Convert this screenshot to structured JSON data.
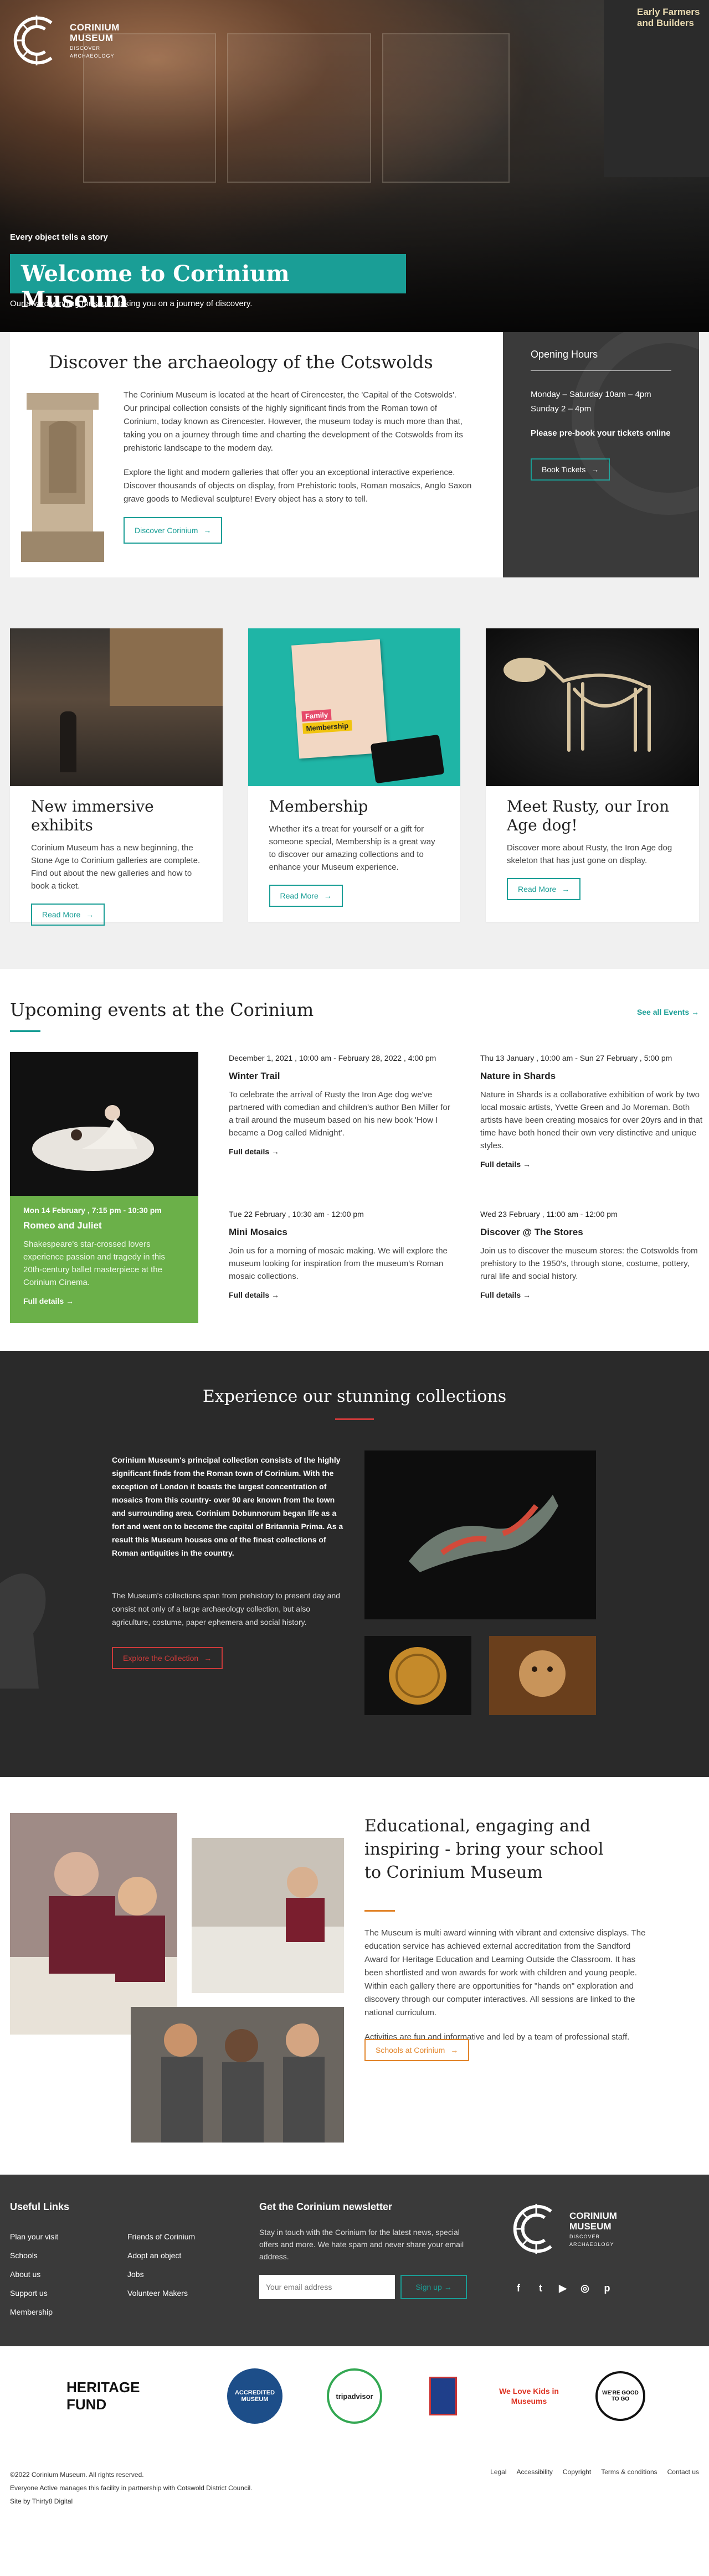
{
  "brand": {
    "name1": "CORINIUM",
    "name2": "MUSEUM",
    "tagline1": "DISCOVER",
    "tagline2": "ARCHAEOLOGY"
  },
  "hero": {
    "kicker": "Every object tells a story",
    "title": "Welcome to Corinium Museum",
    "subtitle": "Our award winning museum, taking you on a journey of discovery.",
    "board_text": "Early Farmers and Builders"
  },
  "intro": {
    "heading": "Discover the archaeology of the Cotswolds",
    "para1": "The Corinium Museum is located at the heart of Cirencester, the 'Capital of the Cotswolds'. Our principal collection consists of the highly significant finds from the Roman town of Corinium, today known as Cirencester. However, the museum today is much more than that, taking you on a journey through time and charting the development of the Cotswolds from its prehistoric landscape to the modern day.",
    "para2": "Explore the light and modern galleries that offer you an exceptional interactive experience. Discover thousands of objects on display, from Prehistoric tools, Roman mosaics, Anglo Saxon grave goods to Medieval sculpture! Every object has a story to tell.",
    "button": "Discover Corinium"
  },
  "hours": {
    "title": "Opening Hours",
    "line1": "Monday – Saturday 10am – 4pm",
    "line2": "Sunday 2 – 4pm",
    "note": "Please pre-book your tickets online",
    "button": "Book Tickets"
  },
  "features": [
    {
      "title": "New immersive exhibits",
      "text": "Corinium Museum has a new beginning, the Stone Age to Corinium galleries are complete. Find out about the new galleries and how to book a ticket.",
      "button": "Read More"
    },
    {
      "title": "Membership",
      "text": "Whether it's a treat for yourself or a gift for someone special, Membership is a great way to discover our amazing collections and to enhance your Museum experience.",
      "button": "Read More",
      "img_label1": "Family",
      "img_label2": "Membership"
    },
    {
      "title": "Meet Rusty, our Iron Age dog!",
      "text": "Discover more about Rusty, the Iron Age dog skeleton that has just gone on display.",
      "button": "Read More"
    }
  ],
  "events": {
    "heading": "Upcoming events at the Corinium",
    "see_all": "See all Events",
    "featured": {
      "date": "Mon 14 February , 7:15 pm - 10:30 pm",
      "title": "Romeo and Juliet",
      "text": "Shakespeare's star-crossed lovers experience passion and tragedy in this 20th-century ballet masterpiece at the Corinium Cinema.",
      "more": "Full details"
    },
    "items": [
      {
        "date": "December 1, 2021 , 10:00 am - February 28, 2022 , 4:00 pm",
        "title": "Winter Trail",
        "text": "To celebrate the arrival of Rusty the Iron Age dog we've partnered with comedian and children's author Ben Miller for a trail around the museum based on his new book 'How I became a Dog called Midnight'.",
        "more": "Full details"
      },
      {
        "date": "Thu 13 January , 10:00 am - Sun 27 February , 5:00 pm",
        "title": "Nature in Shards",
        "text": "Nature in Shards is a collaborative exhibition of work by two local mosaic artists, Yvette Green and Jo Moreman. Both artists have been creating mosaics for over 20yrs and in that time have both honed their own very distinctive and unique styles.",
        "more": "Full details"
      },
      {
        "date": "Tue 22 February , 10:30 am - 12:00 pm",
        "title": "Mini Mosaics",
        "text": "Join us for a morning of mosaic making. We will explore the museum looking for inspiration from the museum's Roman mosaic collections.",
        "more": "Full details"
      },
      {
        "date": "Wed 23 February , 11:00 am - 12:00 pm",
        "title": "Discover @ The Stores",
        "text": "Join us to discover the museum stores: the Cotswolds from prehistory to the 1950's, through stone, costume, pottery, rural life and social history.",
        "more": "Full details"
      }
    ]
  },
  "collections": {
    "heading": "Experience our stunning collections",
    "lead": "Corinium Museum's principal collection consists of the highly significant finds from the Roman town of Corinium. With the exception of London it boasts the largest concentration of mosaics from this country- over 90 are known from the town and surrounding area. Corinium Dobunnorum began life as a fort and went on to become the capital of Britannia Prima. As a result this Museum houses one of the finest collections of Roman antiquities in the country.",
    "body": "The Museum's collections span from prehistory to present day and consist not only of a large archaeology collection, but also agriculture, costume, paper ephemera and social history.",
    "button": "Explore the Collection"
  },
  "schools": {
    "heading": "Educational, engaging and inspiring - bring your school to Corinium Museum",
    "para1": "The Museum is multi award winning with vibrant and extensive displays. The education service has achieved external accreditation from the Sandford Award for Heritage Education and Learning Outside the Classroom. It has been shortlisted and won awards for work with children and young people. Within each gallery there are opportunities for \"hands on\" exploration and discovery through our computer interactives. All sessions are linked to the national curriculum.",
    "para2": "Activities are fun and informative and led by a team of professional staff.",
    "button": "Schools at Corinium"
  },
  "footer": {
    "useful_title": "Useful Links",
    "links_col1": [
      "Plan your visit",
      "Schools",
      "About us",
      "Support us",
      "Membership"
    ],
    "links_col2": [
      "Friends of Corinium",
      "Adopt an object",
      "Jobs",
      "Volunteer Makers"
    ],
    "newsletter_title": "Get the Corinium newsletter",
    "newsletter_text": "Stay in touch with the Corinium for the latest news, special offers and more. We hate spam and never share your email address.",
    "email_placeholder": "Your email address",
    "signup": "Sign up"
  },
  "partners": [
    "HERITAGE FUND",
    "ACCREDITED MUSEUM",
    "tripadvisor",
    "We Love Kids in Museums",
    "WE'RE GOOD TO GO"
  ],
  "bottom": {
    "copyright": "©2022 Corinium Museum. All rights reserved.",
    "managed": "Everyone Active manages this facility in partnership with Cotswold District Council.",
    "site_by": "Site by Thirty8 Digital",
    "legal": [
      "Legal",
      "Accessibility",
      "Copyright",
      "Terms & conditions",
      "Contact us"
    ]
  },
  "colors": {
    "teal": "#1a9e96",
    "green": "#6bb049",
    "red": "#cc3a3a",
    "orange": "#e2852b",
    "dark": "#2a2a2a",
    "footer": "#3a3a3a"
  }
}
